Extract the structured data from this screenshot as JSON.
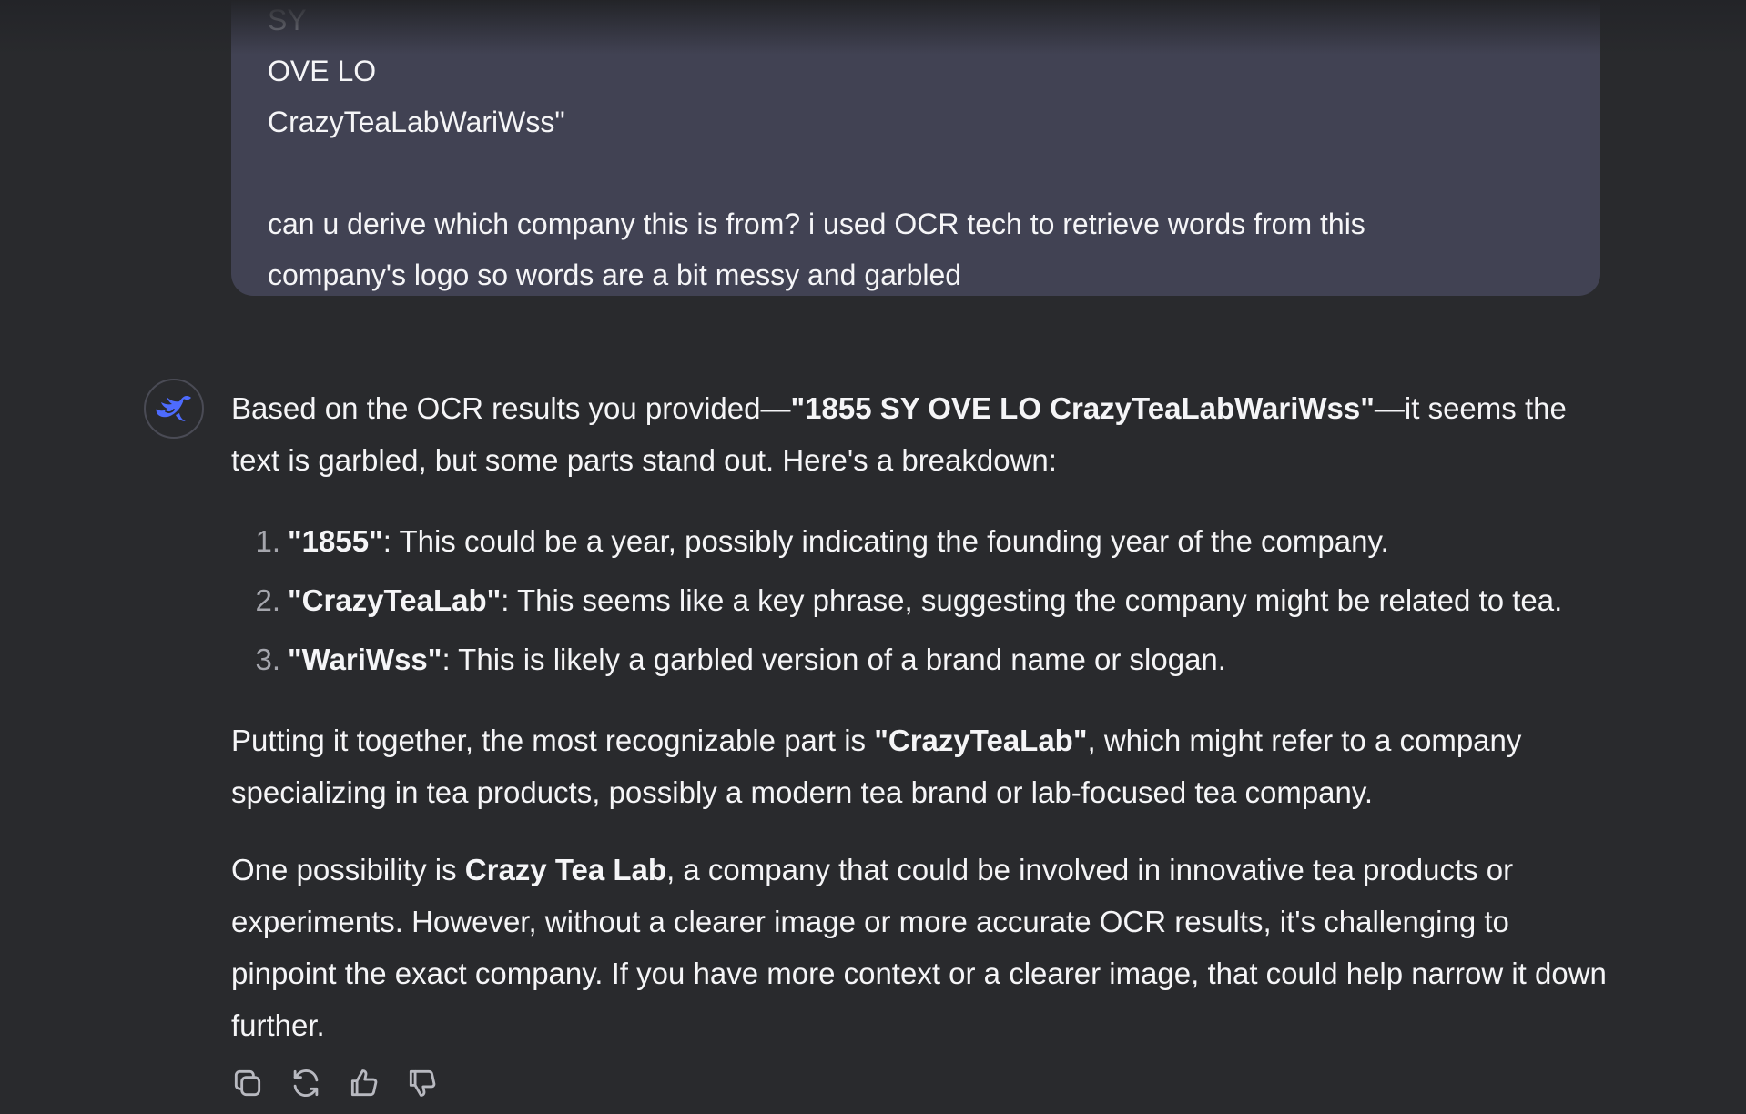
{
  "user_message": {
    "cut_line": "SY",
    "lines": [
      "OVE LO",
      "CrazyTeaLabWariWss\""
    ],
    "question_lines": [
      "can u derive which company this is from? i used OCR tech to retrieve words from this",
      "company's logo so words are a bit messy and garbled"
    ]
  },
  "assistant": {
    "avatar_icon": "whale-logo-icon",
    "accent_color": "#4d6bfe",
    "intro": {
      "before": "Based on the OCR results you provided—",
      "bold": "\"1855 SY OVE LO CrazyTeaLabWariWss\"",
      "after": "—it seems the text is garbled, but some parts stand out. Here's a breakdown:"
    },
    "list": [
      {
        "num": "1.",
        "bold": "\"1855\"",
        "text": ": This could be a year, possibly indicating the founding year of the company."
      },
      {
        "num": "2.",
        "bold": "\"CrazyTeaLab\"",
        "text": ": This seems like a key phrase, suggesting the company might be related to tea."
      },
      {
        "num": "3.",
        "bold": "\"WariWss\"",
        "text": ": This is likely a garbled version of a brand name or slogan."
      }
    ],
    "para2": {
      "before": "Putting it together, the most recognizable part is ",
      "bold": "\"CrazyTeaLab\"",
      "after": ", which might refer to a company specializing in tea products, possibly a modern tea brand or lab-focused tea company."
    },
    "para3": {
      "before": "One possibility is ",
      "bold": "Crazy Tea Lab",
      "after": ", a company that could be involved in innovative tea products or experiments. However, without a clearer image or more accurate OCR results, it's challenging to pinpoint the exact company. If you have more context or a clearer image, that could help narrow it down further."
    }
  },
  "actions": [
    {
      "icon": "copy-icon"
    },
    {
      "icon": "regenerate-icon"
    },
    {
      "icon": "thumbs-up-icon"
    },
    {
      "icon": "thumbs-down-icon"
    }
  ]
}
